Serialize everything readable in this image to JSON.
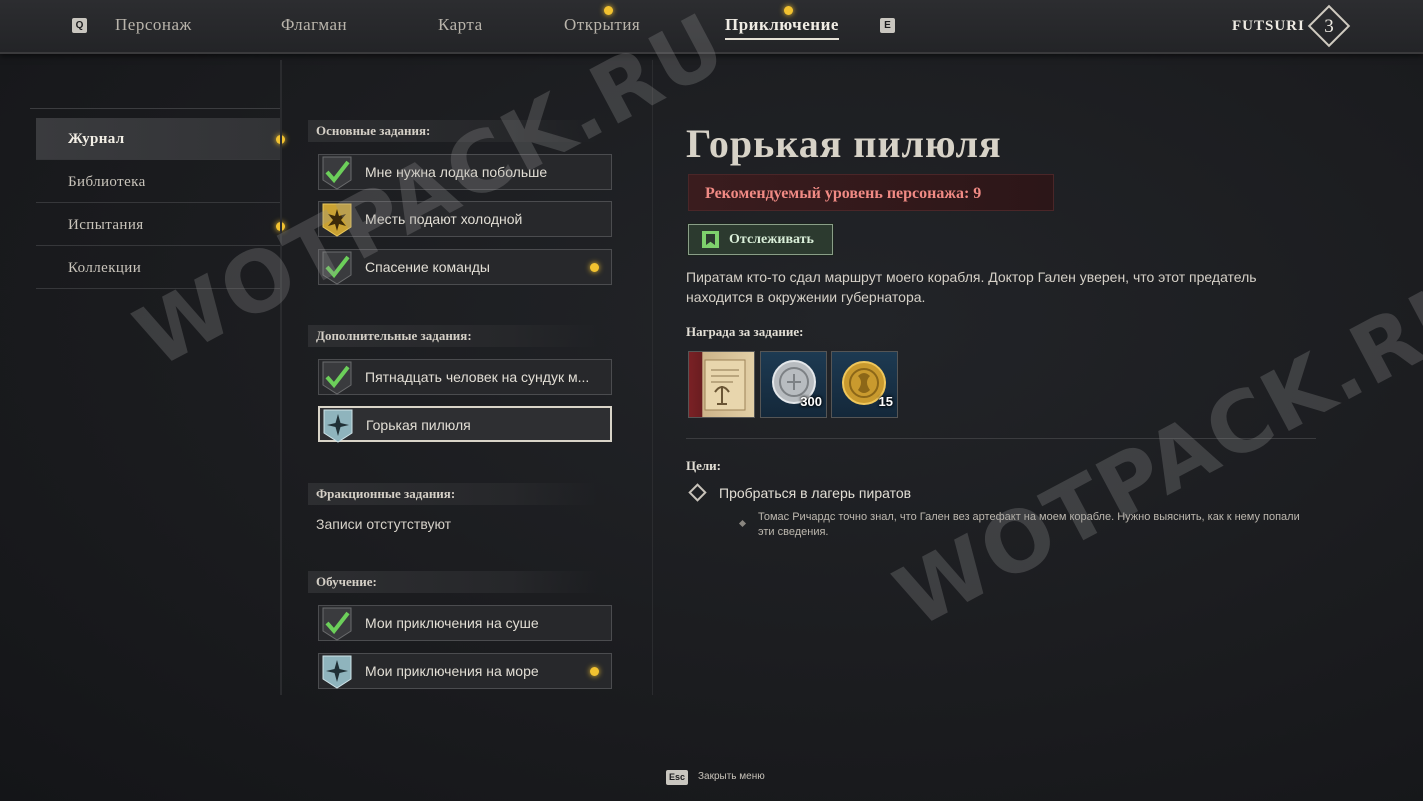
{
  "top_nav": {
    "key_left": "Q",
    "key_right": "E",
    "tabs": [
      {
        "label": "Персонаж",
        "active": false,
        "notification": false
      },
      {
        "label": "Флагман",
        "active": false,
        "notification": false
      },
      {
        "label": "Карта",
        "active": false,
        "notification": false
      },
      {
        "label": "Открытия",
        "active": false,
        "notification": true
      },
      {
        "label": "Приключение",
        "active": true,
        "notification": true
      }
    ],
    "player_name": "FUTSURI",
    "player_level": "3"
  },
  "sidebar": {
    "items": [
      {
        "label": "Журнал",
        "active": true,
        "notification": true
      },
      {
        "label": "Библиотека",
        "active": false,
        "notification": false
      },
      {
        "label": "Испытания",
        "active": false,
        "notification": true
      },
      {
        "label": "Коллекции",
        "active": false,
        "notification": false
      }
    ]
  },
  "quest_list": {
    "main": {
      "heading": "Основные задания:",
      "items": [
        {
          "label": "Мне нужна лодка побольше",
          "status": "completed",
          "notification": false
        },
        {
          "label": "Месть подают холодной",
          "status": "gold",
          "notification": false
        },
        {
          "label": "Спасение команды",
          "status": "completed",
          "notification": true
        }
      ]
    },
    "side": {
      "heading": "Дополнительные задания:",
      "items": [
        {
          "label": "Пятнадцать человек на сундук м...",
          "status": "completed",
          "notification": false
        },
        {
          "label": "Горькая пилюля",
          "status": "active",
          "notification": false,
          "selected": true
        }
      ]
    },
    "faction": {
      "heading": "Фракционные задания:",
      "empty_text": "Записи отстутствуют"
    },
    "training": {
      "heading": "Обучение:",
      "items": [
        {
          "label": "Мои приключения на суше",
          "status": "completed",
          "notification": false
        },
        {
          "label": "Мои приключения на море",
          "status": "active",
          "notification": true
        }
      ]
    }
  },
  "detail": {
    "title": "Горькая пилюля",
    "recommended_level": "Рекомендуемый уровень персонажа: 9",
    "track_button": "Отслеживать",
    "description": "Пиратам кто-то сдал маршрут моего корабля. Доктор Гален уверен, что этот предатель находится в окружении губернатора.",
    "reward_heading": "Награда за задание:",
    "rewards": [
      {
        "icon": "document-icon",
        "quantity": ""
      },
      {
        "icon": "silver-coin-icon",
        "quantity": "300"
      },
      {
        "icon": "gold-coin-icon",
        "quantity": "15"
      }
    ],
    "goals_heading": "Цели:",
    "goal": "Пробраться в лагерь пиратов",
    "goal_note": "Томас Ричардс точно знал, что Гален вез артефакт на моем корабле. Нужно выяснить, как к нему попали эти сведения."
  },
  "footer": {
    "key": "Esc",
    "label": "Закрыть меню"
  },
  "watermark": "WOTPACK.RU",
  "colors": {
    "notification": "#f2c230",
    "recommended_text": "#f08a84",
    "track_accent": "#7ed06c",
    "check_green": "#6ccf5a"
  }
}
